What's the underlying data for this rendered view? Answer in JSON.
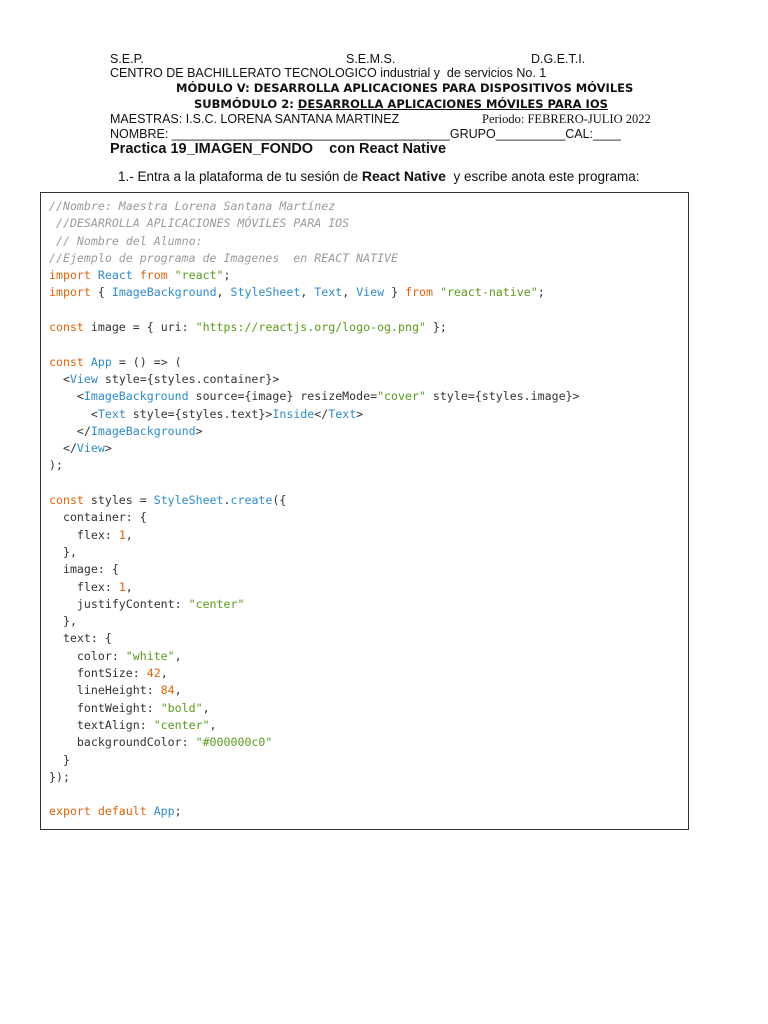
{
  "header": {
    "sep": "S.E.P.",
    "sems": "S.E.M.S.",
    "dgeti": "D.G.E.T.I.",
    "centro": "CENTRO DE BACHILLERATO TECNOLOGICO industrial y  de servicios No. 1",
    "modulo": "MÓDULO V: DESARROLLA APLICACIONES PARA DISPOSITIVOS MÓVILES",
    "submodulo_prefix": "SUBMÓDULO 2: ",
    "submodulo": "DESARROLLA APLICACIONES MÓVILES PARA IOS",
    "maestras": "MAESTRAS: I.S.C. LORENA SANTANA MARTINEZ",
    "periodo": "Periodo: FEBRERO-JULIO 2022",
    "nombre": "NOMBRE: ________________________________________GRUPO__________CAL:____",
    "practica": "Practica 19_IMAGEN_FONDO    con React Native"
  },
  "instruction": {
    "pre": "1.- Entra a la plataforma de tu sesión de ",
    "bold": "React Native",
    "post": "  y escribe anota este programa:"
  },
  "code": [
    [
      [
        "c",
        "//Nombre: Maestra Lorena Santana Martínez"
      ]
    ],
    [
      [
        "c",
        " //DESARROLLA APLICACIONES MÓVILES PARA IOS"
      ]
    ],
    [
      [
        "c",
        " // Nombre del Alumno:"
      ]
    ],
    [
      [
        "c",
        "//Ejemplo de programa de Imagenes  en REACT NATIVE"
      ]
    ],
    [
      [
        "k",
        "import "
      ],
      [
        "i",
        "React "
      ],
      [
        "k",
        "from "
      ],
      [
        "s",
        "\"react\""
      ],
      [
        "p",
        ";"
      ]
    ],
    [
      [
        "k",
        "import "
      ],
      [
        "p",
        "{ "
      ],
      [
        "i",
        "ImageBackground"
      ],
      [
        "p",
        ", "
      ],
      [
        "i",
        "StyleSheet"
      ],
      [
        "p",
        ", "
      ],
      [
        "i",
        "Text"
      ],
      [
        "p",
        ", "
      ],
      [
        "i",
        "View"
      ],
      [
        "p",
        " } "
      ],
      [
        "k",
        "from "
      ],
      [
        "s",
        "\"react-native\""
      ],
      [
        "p",
        ";"
      ]
    ],
    [],
    [
      [
        "k",
        "const "
      ],
      [
        "p",
        "image = { uri: "
      ],
      [
        "s",
        "\"https://reactjs.org/logo-og.png\""
      ],
      [
        "p",
        " };"
      ]
    ],
    [],
    [
      [
        "k",
        "const "
      ],
      [
        "i",
        "App"
      ],
      [
        "p",
        " = () => ("
      ]
    ],
    [
      [
        "p",
        "  <"
      ],
      [
        "i",
        "View"
      ],
      [
        "p",
        " style={styles.container}>"
      ]
    ],
    [
      [
        "p",
        "    <"
      ],
      [
        "i",
        "ImageBackground"
      ],
      [
        "p",
        " source={image} resizeMode="
      ],
      [
        "s",
        "\"cover\""
      ],
      [
        "p",
        " style={styles.image}>"
      ]
    ],
    [
      [
        "p",
        "      <"
      ],
      [
        "i",
        "Text"
      ],
      [
        "p",
        " style={styles.text}>"
      ],
      [
        "i",
        "Inside"
      ],
      [
        "p",
        "</"
      ],
      [
        "i",
        "Text"
      ],
      [
        "p",
        ">"
      ]
    ],
    [
      [
        "p",
        "    </"
      ],
      [
        "i",
        "ImageBackground"
      ],
      [
        "p",
        ">"
      ]
    ],
    [
      [
        "p",
        "  </"
      ],
      [
        "i",
        "View"
      ],
      [
        "p",
        ">"
      ]
    ],
    [
      [
        "p",
        ");"
      ]
    ],
    [],
    [
      [
        "k",
        "const "
      ],
      [
        "p",
        "styles = "
      ],
      [
        "i",
        "StyleSheet"
      ],
      [
        "p",
        "."
      ],
      [
        "i",
        "create"
      ],
      [
        "p",
        "({"
      ]
    ],
    [
      [
        "p",
        "  container: {"
      ]
    ],
    [
      [
        "p",
        "    flex: "
      ],
      [
        "n",
        "1"
      ],
      [
        "p",
        ","
      ]
    ],
    [
      [
        "p",
        "  },"
      ]
    ],
    [
      [
        "p",
        "  image: {"
      ]
    ],
    [
      [
        "p",
        "    flex: "
      ],
      [
        "n",
        "1"
      ],
      [
        "p",
        ","
      ]
    ],
    [
      [
        "p",
        "    justifyContent: "
      ],
      [
        "s",
        "\"center\""
      ]
    ],
    [
      [
        "p",
        "  },"
      ]
    ],
    [
      [
        "p",
        "  text: {"
      ]
    ],
    [
      [
        "p",
        "    color: "
      ],
      [
        "s",
        "\"white\""
      ],
      [
        "p",
        ","
      ]
    ],
    [
      [
        "p",
        "    fontSize: "
      ],
      [
        "n",
        "42"
      ],
      [
        "p",
        ","
      ]
    ],
    [
      [
        "p",
        "    lineHeight: "
      ],
      [
        "n",
        "84"
      ],
      [
        "p",
        ","
      ]
    ],
    [
      [
        "p",
        "    fontWeight: "
      ],
      [
        "s",
        "\"bold\""
      ],
      [
        "p",
        ","
      ]
    ],
    [
      [
        "p",
        "    textAlign: "
      ],
      [
        "s",
        "\"center\""
      ],
      [
        "p",
        ","
      ]
    ],
    [
      [
        "p",
        "    backgroundColor: "
      ],
      [
        "s",
        "\"#000000c0\""
      ]
    ],
    [
      [
        "p",
        "  }"
      ]
    ],
    [
      [
        "p",
        "});"
      ]
    ],
    [],
    [
      [
        "k",
        "export default "
      ],
      [
        "i",
        "App"
      ],
      [
        "p",
        ";"
      ]
    ]
  ]
}
